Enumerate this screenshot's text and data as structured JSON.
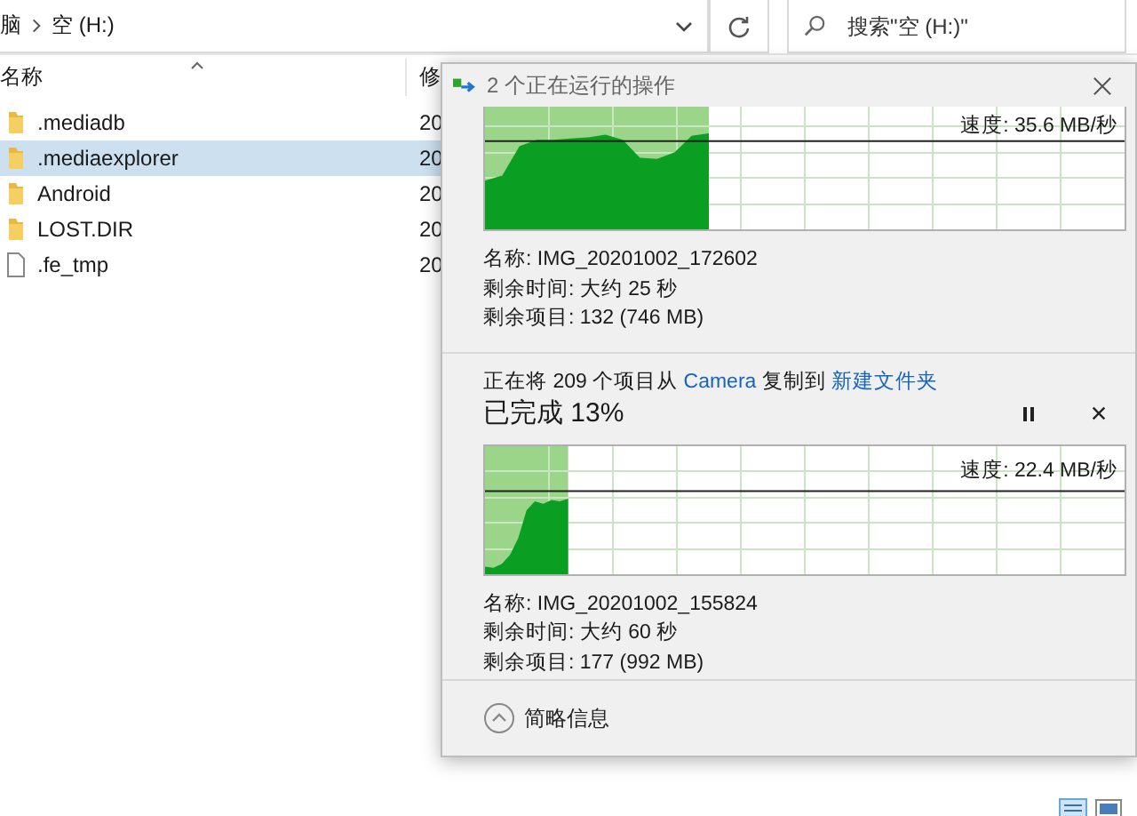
{
  "explorer": {
    "breadcrumb": [
      "脑",
      "空 (H:)"
    ],
    "search": {
      "placeholder": "搜索\"空 (H:)\""
    },
    "columns": [
      "名称",
      "修"
    ],
    "files": [
      {
        "name": ".mediadb",
        "kind": "folder",
        "date": "20",
        "selected": false
      },
      {
        "name": ".mediaexplorer",
        "kind": "folder",
        "date": "20",
        "selected": true
      },
      {
        "name": "Android",
        "kind": "folder",
        "date": "20",
        "selected": false
      },
      {
        "name": "LOST.DIR",
        "kind": "folder",
        "date": "20",
        "selected": false
      },
      {
        "name": ".fe_tmp",
        "kind": "file",
        "date": "20",
        "selected": false
      }
    ]
  },
  "dialog": {
    "title": "2 个正在运行的操作",
    "operations": [
      {
        "speed": "速度: 35.6 MB/秒",
        "level": 0.35,
        "details": [
          "名称: IMG_20201002_172602",
          "剩余时间: 大约 25 秒",
          "剩余项目: 132 (746 MB)"
        ]
      },
      {
        "heading": [
          {
            "kind": "text",
            "text": "正在将 209 个项目从 "
          },
          {
            "kind": "link",
            "text": "Camera"
          },
          {
            "kind": "text",
            "text": " 复制到 "
          },
          {
            "kind": "link",
            "text": "新建文件夹"
          }
        ],
        "progress": "已完成 13%",
        "speed": "速度: 22.4 MB/秒",
        "level": 0.13,
        "details": [
          "名称: IMG_20201002_155824",
          "剩余时间: 大约 60 秒",
          "剩余项目: 177 (992 MB)"
        ]
      }
    ],
    "footer": "简略信息"
  }
}
